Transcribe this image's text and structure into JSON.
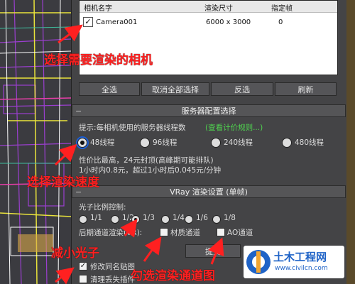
{
  "camera_table": {
    "headers": [
      "相机名字",
      "渲染尺寸",
      "指定帧"
    ],
    "rows": [
      {
        "checked": "✓",
        "name": "Camera001",
        "size": "6000 x 3000",
        "frame": "0"
      }
    ]
  },
  "camera_buttons": [
    "全选",
    "取消全部选择",
    "反选",
    "刷新"
  ],
  "server_group": {
    "title": "服务器配置选择",
    "hint_label": "提示:每相机使用的服务器线程数",
    "hint_link": "(查看计价规则...)",
    "thread_options": [
      "48线程",
      "96线程",
      "240线程",
      "480线程"
    ],
    "selected_index": 0,
    "desc_line1": "性价比最高，24元封顶(高峰期可能排队)",
    "desc_line2": "1小时内0.8元，超过1小时后0.045元/分钟"
  },
  "vray_group": {
    "title": "VRay 渲染设置 (单帧)",
    "photon_label": "光子比例控制:",
    "photon_options": [
      "1/1",
      "1/2",
      "1/3",
      "1/4",
      "1/6",
      "1/8"
    ],
    "photon_selected_index": 2,
    "post_label": "后期通道渲染(VR):",
    "post_options": [
      "材质通道",
      "AO通道"
    ]
  },
  "submit_label": "提交",
  "bottom_checks": [
    {
      "label": "修改同名贴图",
      "checked": "✓"
    },
    {
      "label": "清理丢失插件",
      "checked": ""
    }
  ],
  "annotations": {
    "select_camera": "选择需要渲染的相机",
    "select_speed": "选择渲染速度",
    "reduce_photon": "减小光子",
    "check_channels": "勾选渲染通道图"
  },
  "watermark": {
    "title": "土木工程网",
    "url": "www.civilcn.com"
  },
  "colors": {
    "annotation": "#ff2020",
    "link": "#4fd34f",
    "watermark": "#1f63c7"
  }
}
